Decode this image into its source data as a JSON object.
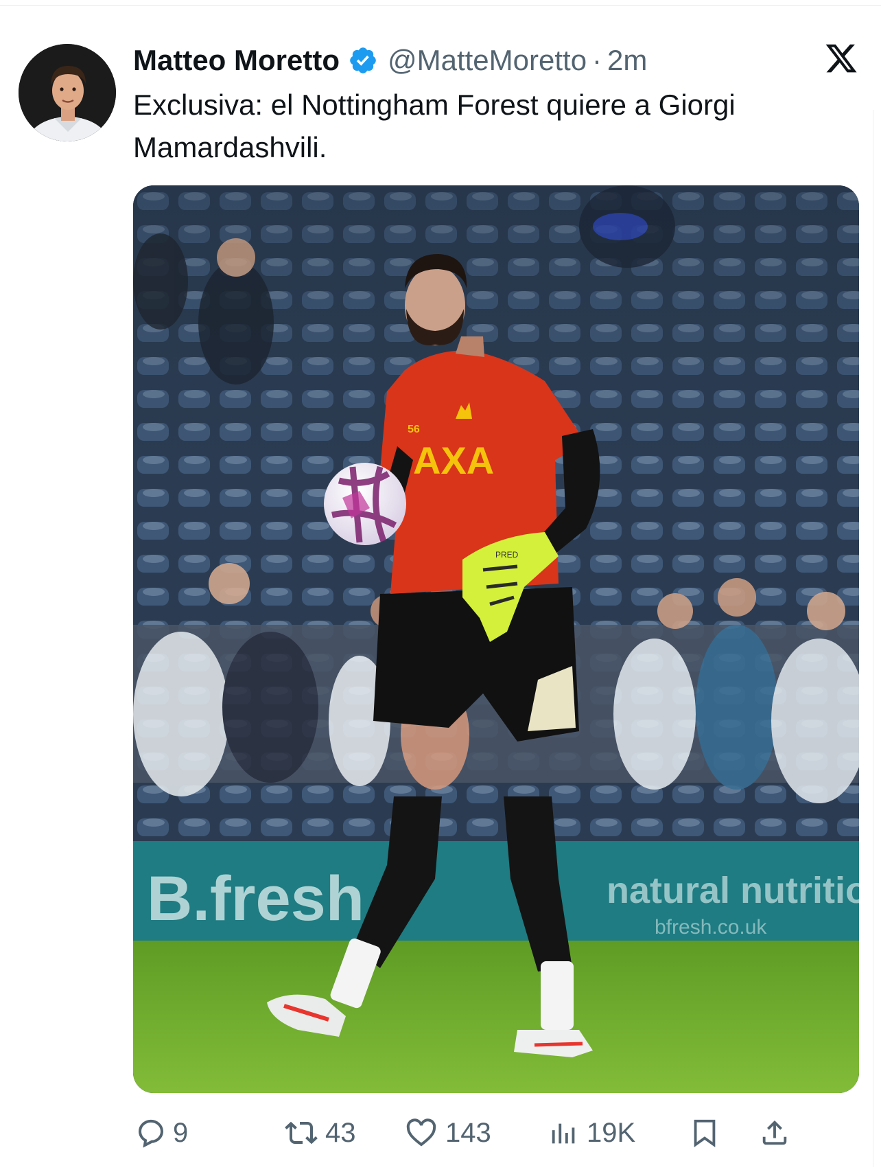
{
  "tweet": {
    "author_name": "Matteo Moretto",
    "handle": "@MatteMoretto",
    "separator": "·",
    "time": "2m",
    "text": "Exclusiva: el Nottingham Forest quiere a Giorgi Mamardashvili."
  },
  "photo": {
    "shirt_sponsor": "AXA",
    "shirt_number": "56",
    "glove_brand": "PRED",
    "board_left": "B.fresh",
    "board_right": "natural nutrition",
    "board_url": "bfresh.co.uk"
  },
  "actions": {
    "replies": "9",
    "reposts": "43",
    "likes": "143",
    "views": "19K"
  },
  "colors": {
    "verified_badge": "#1d9bf0",
    "secondary_text": "#536471",
    "shirt": "#d8351a",
    "sponsor": "#f5c30c",
    "gloves": "#d4f03a",
    "pitch": "#6fae2c"
  },
  "icons": [
    "x-logo-icon",
    "verified-badge-icon",
    "reply-icon",
    "repost-icon",
    "like-icon",
    "views-icon",
    "bookmark-icon",
    "share-icon"
  ]
}
